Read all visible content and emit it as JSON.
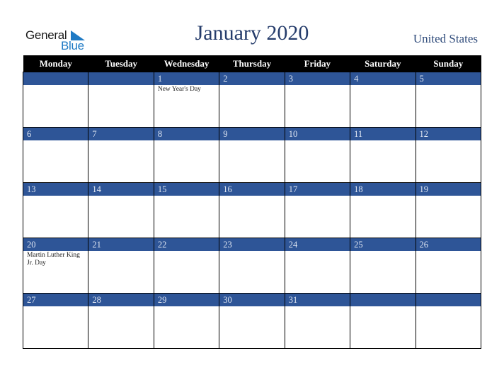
{
  "logo": {
    "line1": "General",
    "line2": "Blue",
    "icon": "triangle-flag-icon",
    "color": "#1f7ac4"
  },
  "header": {
    "title": "January 2020",
    "country": "United States"
  },
  "colors": {
    "header_bg": "#000000",
    "week_band": "#2e5597",
    "title": "#253c6b"
  },
  "days_of_week": [
    "Monday",
    "Tuesday",
    "Wednesday",
    "Thursday",
    "Friday",
    "Saturday",
    "Sunday"
  ],
  "weeks": [
    [
      {
        "day": "",
        "event": ""
      },
      {
        "day": "",
        "event": ""
      },
      {
        "day": "1",
        "event": "New Year's Day"
      },
      {
        "day": "2",
        "event": ""
      },
      {
        "day": "3",
        "event": ""
      },
      {
        "day": "4",
        "event": ""
      },
      {
        "day": "5",
        "event": ""
      }
    ],
    [
      {
        "day": "6",
        "event": ""
      },
      {
        "day": "7",
        "event": ""
      },
      {
        "day": "8",
        "event": ""
      },
      {
        "day": "9",
        "event": ""
      },
      {
        "day": "10",
        "event": ""
      },
      {
        "day": "11",
        "event": ""
      },
      {
        "day": "12",
        "event": ""
      }
    ],
    [
      {
        "day": "13",
        "event": ""
      },
      {
        "day": "14",
        "event": ""
      },
      {
        "day": "15",
        "event": ""
      },
      {
        "day": "16",
        "event": ""
      },
      {
        "day": "17",
        "event": ""
      },
      {
        "day": "18",
        "event": ""
      },
      {
        "day": "19",
        "event": ""
      }
    ],
    [
      {
        "day": "20",
        "event": "Martin Luther King Jr. Day"
      },
      {
        "day": "21",
        "event": ""
      },
      {
        "day": "22",
        "event": ""
      },
      {
        "day": "23",
        "event": ""
      },
      {
        "day": "24",
        "event": ""
      },
      {
        "day": "25",
        "event": ""
      },
      {
        "day": "26",
        "event": ""
      }
    ],
    [
      {
        "day": "27",
        "event": ""
      },
      {
        "day": "28",
        "event": ""
      },
      {
        "day": "29",
        "event": ""
      },
      {
        "day": "30",
        "event": ""
      },
      {
        "day": "31",
        "event": ""
      },
      {
        "day": "",
        "event": ""
      },
      {
        "day": "",
        "event": ""
      }
    ]
  ]
}
